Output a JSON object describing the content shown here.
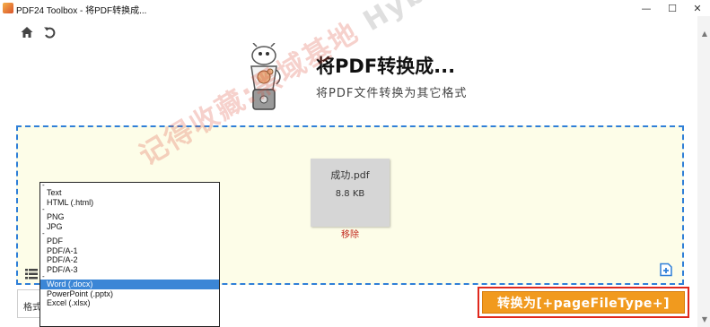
{
  "window": {
    "title": "PDF24 Toolbox - 将PDF转换成...",
    "minimize_glyph": "—",
    "maximize_glyph": "☐",
    "close_glyph": "✕"
  },
  "nav": {
    "home_icon": "home-icon",
    "back_icon": "undo-icon"
  },
  "header": {
    "title": "将PDF转换成...",
    "subtitle": "将PDF文件转换为其它格式"
  },
  "watermark": {
    "cn": "记得收藏:黑域基地",
    "en": "Hybase.com"
  },
  "file": {
    "name": "成功.pdf",
    "size": "8.8 KB",
    "remove_label": "移除"
  },
  "format_select": {
    "visible_text": "格式"
  },
  "dropdown": {
    "groups": [
      [
        "Text",
        "HTML (.html)"
      ],
      [
        "PNG",
        "JPG"
      ],
      [
        "PDF",
        "PDF/A-1",
        "PDF/A-2",
        "PDF/A-3"
      ],
      [
        "Word (.docx)",
        "PowerPoint (.pptx)",
        "Excel (.xlsx)"
      ]
    ],
    "separator": "-",
    "selected": "Word (.docx)"
  },
  "convert_button": {
    "label": "转换为[+pageFileType+]"
  },
  "colors": {
    "accent": "#f19a1e",
    "highlight_border": "#e0281c",
    "dropzone_border": "#2f7fd8",
    "dropzone_bg": "#fdfde8",
    "selected_item": "#3b86d6",
    "remove_link": "#c0271c"
  }
}
